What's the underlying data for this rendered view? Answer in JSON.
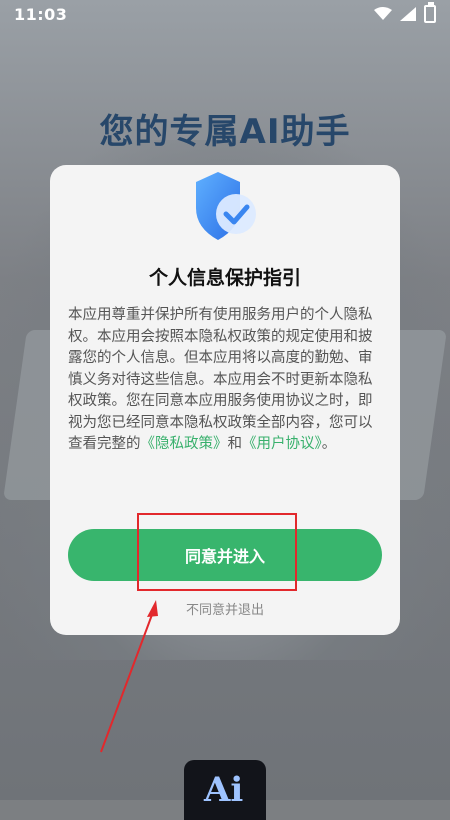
{
  "status_bar": {
    "time": "11:03"
  },
  "background": {
    "headline": "您的专属AI助手",
    "logo_text": "Ai"
  },
  "dialog": {
    "title": "个人信息保护指引",
    "body_text": "本应用尊重并保护所有使用服务用户的个人隐私权。本应用会按照本隐私权政策的规定使用和披露您的个人信息。但本应用将以高度的勤勉、审慎义务对待这些信息。本应用会不时更新本隐私权政策。您在同意本应用服务使用协议之时，即视为您已经同意本隐私权政策全部内容，您可以查看完整的",
    "privacy_link": "《隐私政策》",
    "and_text": "和",
    "terms_link": "《用户协议》",
    "end_text": "。",
    "agree_button": "同意并进入",
    "disagree_link": "不同意并退出"
  },
  "colors": {
    "accent": "#38b56d",
    "link": "#38b06c",
    "annotation": "#e2282c",
    "shield": "#3f8ff5"
  },
  "icons": [
    "wifi-icon",
    "signal-icon",
    "battery-icon",
    "shield-check-icon"
  ]
}
